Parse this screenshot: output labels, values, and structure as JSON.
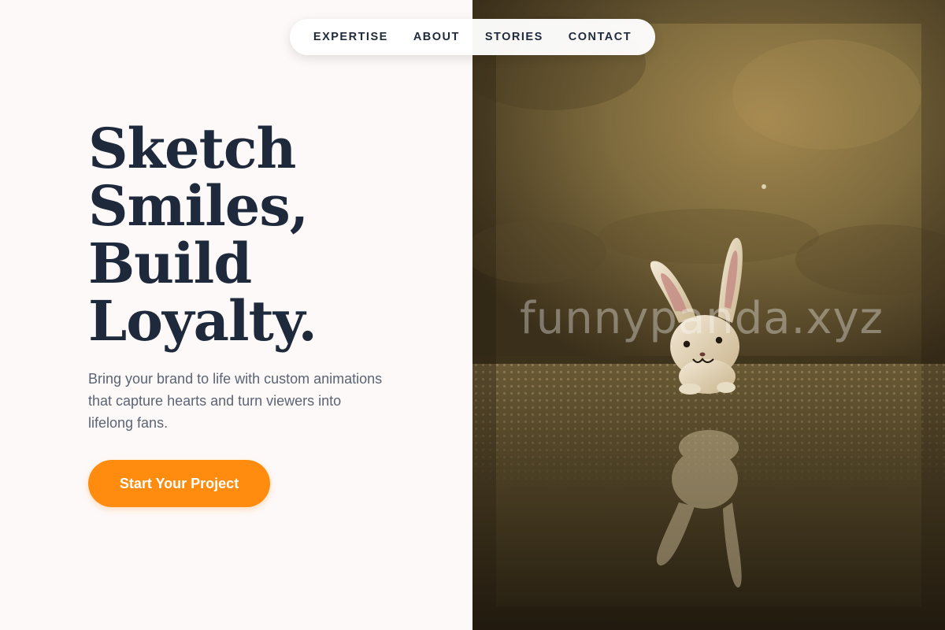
{
  "nav": {
    "items": [
      {
        "label": "EXPERTISE"
      },
      {
        "label": "ABOUT"
      },
      {
        "label": "STORIES"
      },
      {
        "label": "CONTACT"
      }
    ]
  },
  "hero": {
    "title_lines": [
      "Sketch",
      "Smiles,",
      "Build",
      "Loyalty."
    ],
    "subtitle": "Bring your brand to life with custom animations that capture hearts and turn viewers into lifelong fans.",
    "cta_label": "Start Your Project"
  },
  "image": {
    "watermark": "funnypanda.xyz",
    "alt": "bunny figurine photo"
  },
  "colors": {
    "accent": "#ff8c0f",
    "heading": "#1e2a3b",
    "body_text": "#5a6475",
    "background": "#fdf9f8"
  }
}
